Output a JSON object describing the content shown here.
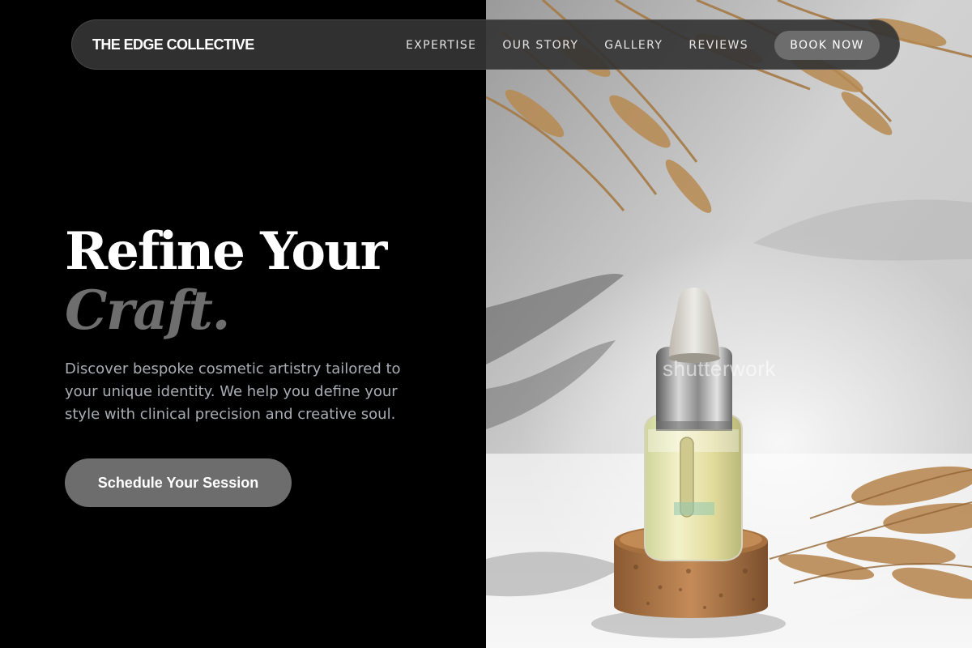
{
  "brand": {
    "name": "THE EDGE COLLECTIVE"
  },
  "nav": {
    "links": [
      {
        "label": "EXPERTISE"
      },
      {
        "label": "OUR STORY"
      },
      {
        "label": "GALLERY"
      },
      {
        "label": "REVIEWS"
      }
    ],
    "book_label": "BOOK NOW"
  },
  "hero": {
    "title": "Refine Your",
    "accent": "Craft.",
    "description": "Discover bespoke cosmetic artistry tailored to your unique identity. We help you define your style with clinical precision and creative soul.",
    "cta_label": "Schedule Your Session"
  },
  "image": {
    "watermark": "shutterwork",
    "subject": "serum-dropper-bottle-on-cork"
  },
  "colors": {
    "background": "#000000",
    "nav_bg": "#343434",
    "button_bg": "#6d6d6d",
    "accent_text": "#6e6e6e",
    "body_text": "#a9adb4"
  }
}
